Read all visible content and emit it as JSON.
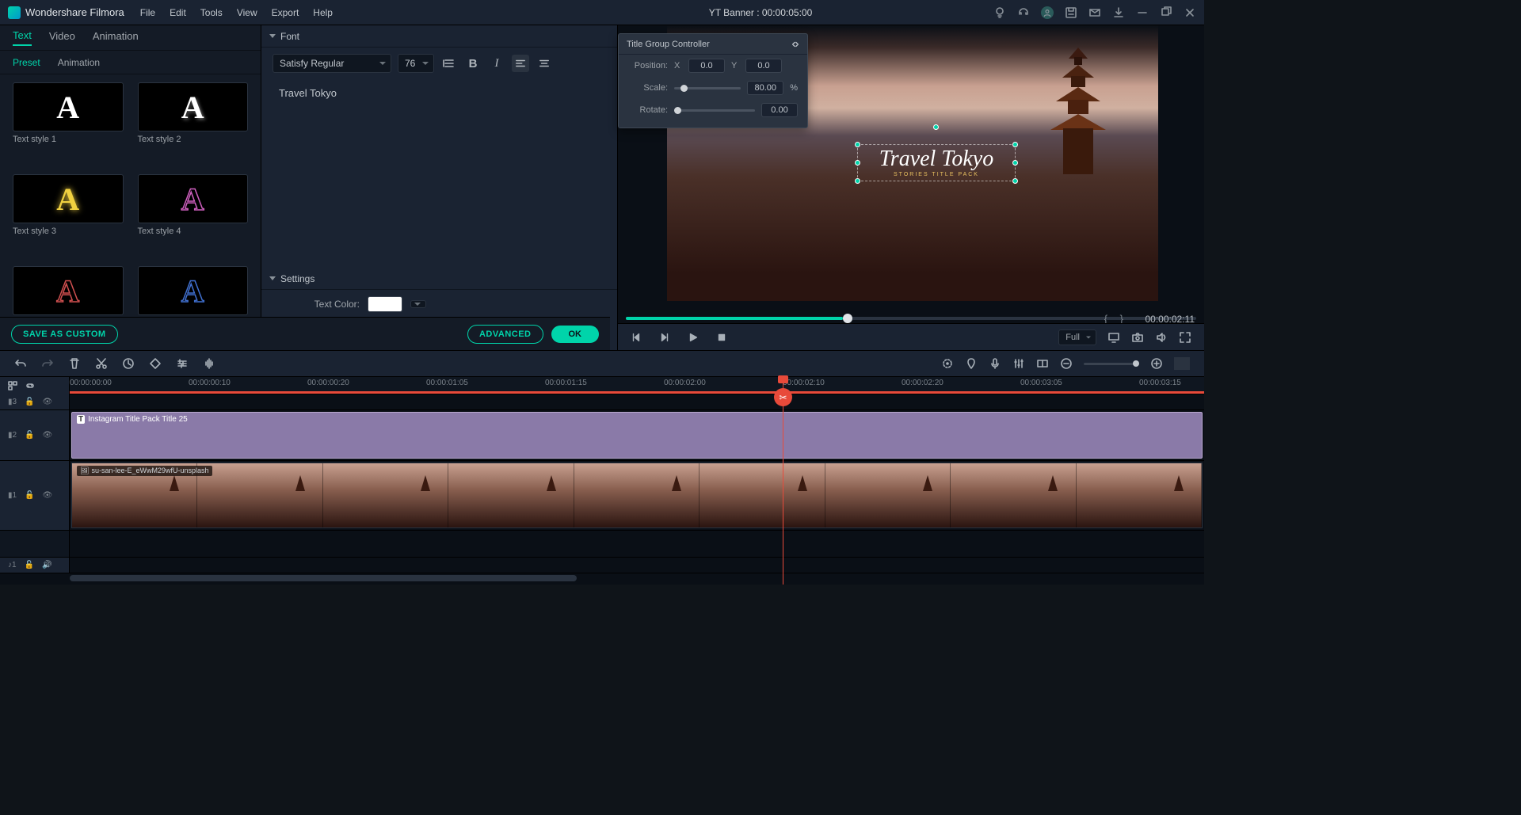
{
  "app": {
    "name": "Wondershare Filmora",
    "project": "YT Banner :  00:00:05:00"
  },
  "menu": [
    "File",
    "Edit",
    "Tools",
    "View",
    "Export",
    "Help"
  ],
  "tabs": [
    "Text",
    "Video",
    "Animation"
  ],
  "subtabs": [
    "Preset",
    "Animation"
  ],
  "presets": [
    {
      "label": "Text style 1",
      "glyph": "A",
      "color": "#ffffff"
    },
    {
      "label": "Text style 2",
      "glyph": "A",
      "color": "#ffffff"
    },
    {
      "label": "Text style 3",
      "glyph": "A",
      "color": "#f0d040"
    },
    {
      "label": "Text style 4",
      "glyph": "A",
      "color": "#d060c0"
    },
    {
      "label": "",
      "glyph": "A",
      "color": "#d05050"
    },
    {
      "label": "",
      "glyph": "A",
      "color": "#4070d0"
    }
  ],
  "font": {
    "section": "Font",
    "family": "Satisfy Regular",
    "size": "76",
    "text": "Travel Tokyo"
  },
  "settings": {
    "section": "Settings",
    "text_color_label": "Text Color:",
    "text_color": "#ffffff"
  },
  "buttons": {
    "save_custom": "SAVE AS CUSTOM",
    "advanced": "ADVANCED",
    "ok": "OK"
  },
  "controller": {
    "title": "Title Group Controller",
    "position_label": "Position:",
    "x_label": "X",
    "x": "0.0",
    "y_label": "Y",
    "y": "0.0",
    "scale_label": "Scale:",
    "scale": "80.00",
    "scale_unit": "%",
    "rotate_label": "Rotate:",
    "rotate": "0.00"
  },
  "preview": {
    "title_text": "Travel Tokyo",
    "subtitle": "STORIES TITLE PACK",
    "timecode": "00:00:02:11",
    "quality": "Full"
  },
  "timeline_tools": {},
  "ruler": [
    "00:00:00:00",
    "00:00:00:10",
    "00:00:00:20",
    "00:00:01:05",
    "00:00:01:15",
    "00:00:02:00",
    "00:00:02:10",
    "00:00:02:20",
    "00:00:03:05",
    "00:00:03:15"
  ],
  "tracks": {
    "t3": "▮3",
    "t2": "▮2",
    "t1": "▮1",
    "audio": "♪1",
    "title_clip": "Instagram Title Pack Title 25",
    "video_clip": "su-san-lee-E_eWwM29wfU-unsplash"
  }
}
